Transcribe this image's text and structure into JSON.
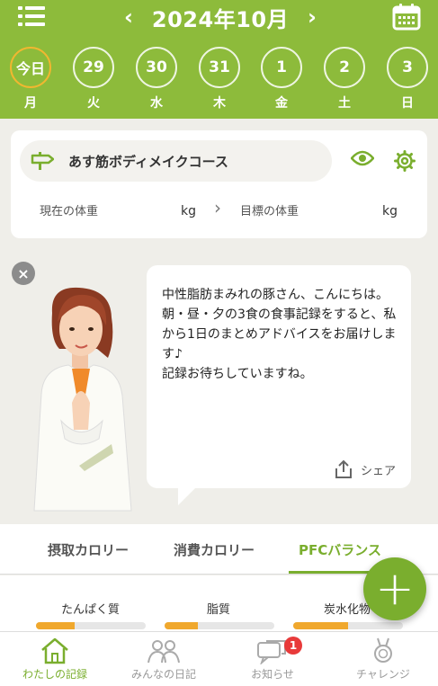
{
  "colors": {
    "header": "#8dbb3b",
    "accent": "#7aae2e",
    "today_ring": "#f1b730",
    "badge": "#e83a3a",
    "bar_fill": "#f0a82d"
  },
  "header": {
    "menu_icon": "hamburger-menu-icon",
    "prev_arrow": "‹",
    "next_arrow": "›",
    "month_title": "2024年10月",
    "calendar_icon": "calendar-icon"
  },
  "days": [
    {
      "num": "今日",
      "weekday": "月",
      "today": true
    },
    {
      "num": "29",
      "weekday": "火"
    },
    {
      "num": "30",
      "weekday": "水"
    },
    {
      "num": "31",
      "weekday": "木"
    },
    {
      "num": "1",
      "weekday": "金"
    },
    {
      "num": "2",
      "weekday": "土"
    },
    {
      "num": "3",
      "weekday": "日"
    }
  ],
  "course": {
    "icon": "signpost-icon",
    "name": "あす筋ボディメイクコース",
    "current_weight_label": "現在の体重",
    "current_weight_unit": "kg",
    "arrow": "›",
    "target_weight_label": "目標の体重",
    "target_weight_unit": "kg"
  },
  "message": {
    "close": "×",
    "text": "中性脂肪まみれの豚さん、こんにちは。\n朝・昼・夕の3食の食事記録をすると、私から1日のまとめアドバイスをお届けします♪\n記録お待ちしていますね。",
    "share_label": "シェア"
  },
  "tabs": [
    {
      "label": "摂取カロリー"
    },
    {
      "label": "消費カロリー"
    },
    {
      "label": "PFCバランス",
      "active": true
    }
  ],
  "pfc": [
    {
      "label": "たんぱく質",
      "fill": 0.35
    },
    {
      "label": "脂質",
      "fill": 0.3
    },
    {
      "label": "炭水化物",
      "fill": 0.5
    }
  ],
  "fab_label": "+",
  "bottom_nav": [
    {
      "label": "わたしの記録",
      "icon": "house-icon",
      "active": true
    },
    {
      "label": "みんなの日記",
      "icon": "people-icon"
    },
    {
      "label": "お知らせ",
      "icon": "chat-bubbles-icon",
      "badge": "1"
    },
    {
      "label": "チャレンジ",
      "icon": "medal-icon"
    }
  ]
}
